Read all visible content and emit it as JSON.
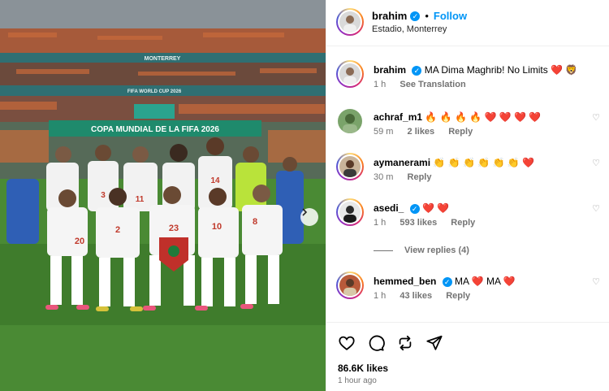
{
  "post": {
    "username": "brahim",
    "follow_label": "Follow",
    "location": "Estadio, Monterrey",
    "photo_banner_text": "COPA MUNDIAL DE LA FIFA 2026",
    "photo_stand_text": "MONTERREY",
    "photo_ribbon_text": "FIFA WORLD CUP 2026",
    "jersey_numbers": [
      "20",
      "2",
      "23",
      "10",
      "8",
      "3",
      "11",
      "14"
    ]
  },
  "caption": {
    "username": "brahim",
    "text": "MA Dima Maghrib! No Limits ❤️ 🦁",
    "time": "1 h",
    "see_translation": "See Translation"
  },
  "comments": [
    {
      "username": "achraf_m1",
      "verified": false,
      "text": "🔥 🔥 🔥 🔥 ❤️ ❤️ ❤️ ❤️",
      "time": "59 m",
      "likes": "2 likes",
      "reply": "Reply"
    },
    {
      "username": "aymanerami",
      "verified": false,
      "text": "👏 👏 👏 👏 👏 👏 ❤️",
      "time": "30 m",
      "likes": "",
      "reply": "Reply"
    },
    {
      "username": "asedi_",
      "verified": true,
      "text": "❤️ ❤️",
      "time": "1 h",
      "likes": "593 likes",
      "reply": "Reply",
      "view_replies": "View replies (4)"
    },
    {
      "username": "hemmed_ben",
      "verified": true,
      "text": "MA ❤️ MA ❤️",
      "time": "1 h",
      "likes": "43 likes",
      "reply": "Reply"
    }
  ],
  "footer": {
    "likes": "86.6K likes",
    "time_ago": "1 hour ago"
  },
  "icons": {
    "like": "heart-icon",
    "comment": "comment-icon",
    "repost": "repost-icon",
    "share": "share-icon",
    "verified": "verified-badge-icon",
    "next": "chevron-right-icon"
  },
  "colors": {
    "accent": "#0095f6",
    "muted": "#737373",
    "heart": "#ed4956"
  }
}
